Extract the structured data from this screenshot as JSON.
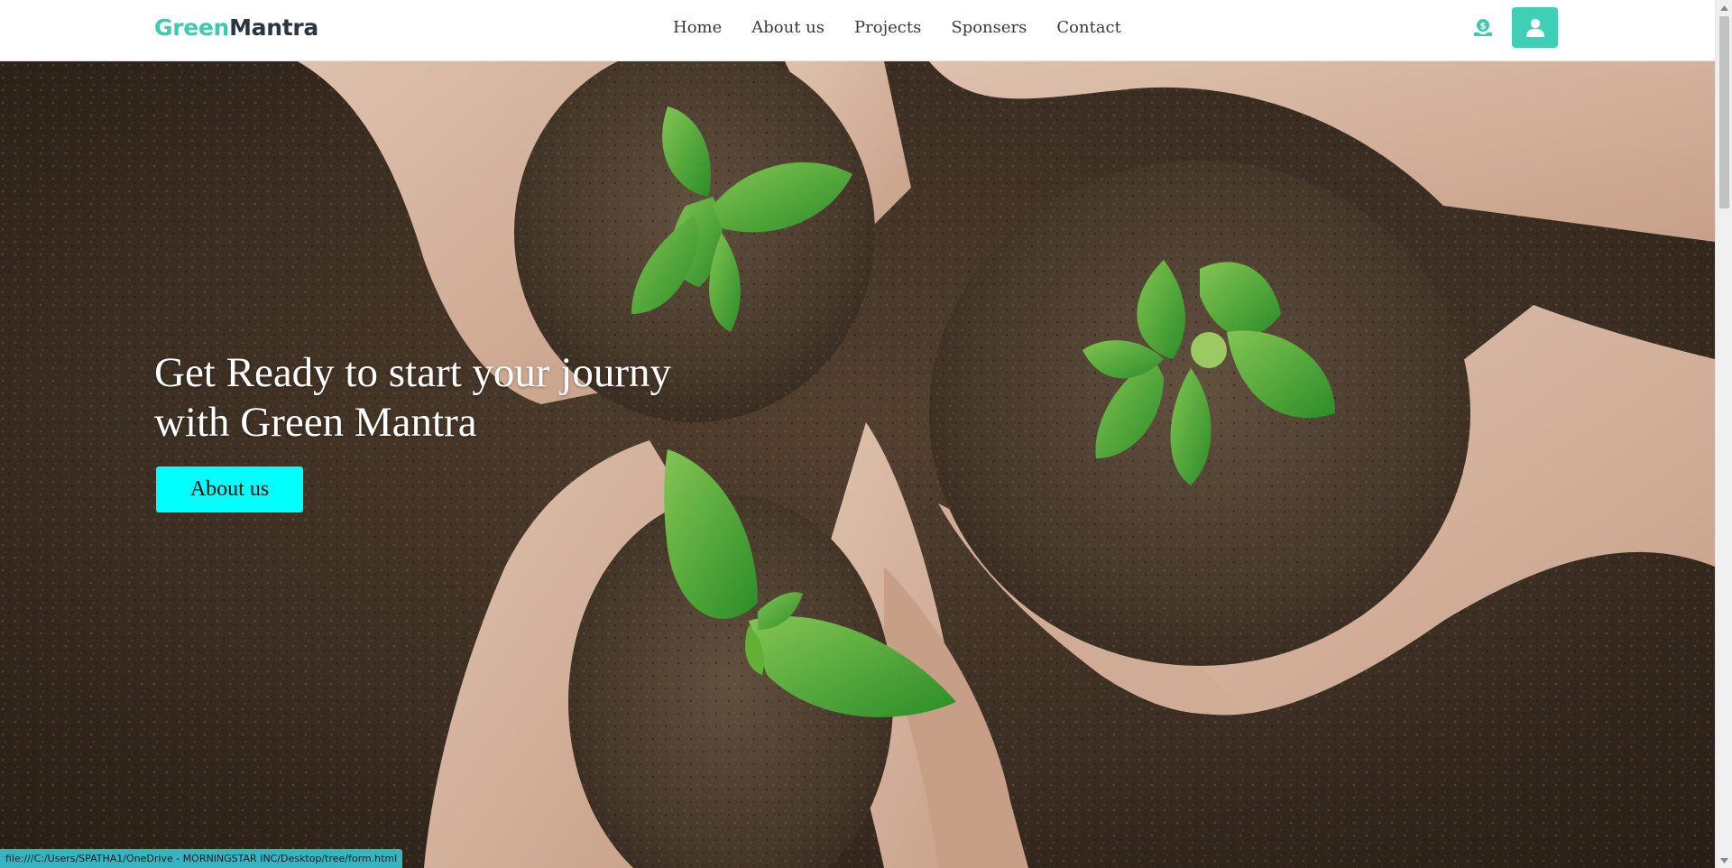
{
  "brand": {
    "part1": "Green",
    "part2": "Mantra"
  },
  "nav": {
    "items": [
      {
        "label": "Home"
      },
      {
        "label": "About us"
      },
      {
        "label": "Projects"
      },
      {
        "label": "Sponsers"
      },
      {
        "label": "Contact"
      }
    ]
  },
  "header_actions": {
    "donate_icon": "donate-icon",
    "user_icon": "user-icon",
    "accent_color": "#3fcfb7"
  },
  "hero": {
    "title_line1": "Get Ready to start your journy",
    "title_line2": "with Green Mantra",
    "button_label": "About us",
    "button_color": "#00ffff",
    "background_image": "hands-holding-soil-with-seedlings"
  },
  "status_bar": {
    "url": "file:///C:/Users/SPATHA1/OneDrive - MORNINGSTAR INC/Desktop/tree/form.html"
  }
}
